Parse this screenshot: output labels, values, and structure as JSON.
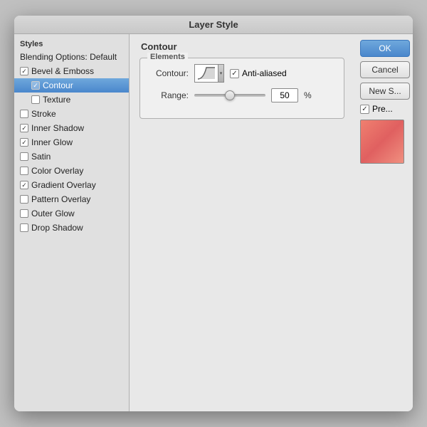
{
  "dialog": {
    "title": "Layer Style",
    "left_panel": {
      "header": "Styles",
      "items": [
        {
          "id": "blending-options",
          "label": "Blending Options: Default",
          "type": "header",
          "checked": false,
          "selected": false
        },
        {
          "id": "bevel-emboss",
          "label": "Bevel & Emboss",
          "type": "parent",
          "checked": true,
          "selected": false
        },
        {
          "id": "contour",
          "label": "Contour",
          "type": "sub",
          "checked": true,
          "selected": true
        },
        {
          "id": "texture",
          "label": "Texture",
          "type": "sub",
          "checked": false,
          "selected": false
        },
        {
          "id": "stroke",
          "label": "Stroke",
          "type": "top",
          "checked": false,
          "selected": false
        },
        {
          "id": "inner-shadow",
          "label": "Inner Shadow",
          "type": "top",
          "checked": true,
          "selected": false
        },
        {
          "id": "inner-glow",
          "label": "Inner Glow",
          "type": "top",
          "checked": true,
          "selected": false
        },
        {
          "id": "satin",
          "label": "Satin",
          "type": "top",
          "checked": false,
          "selected": false
        },
        {
          "id": "color-overlay",
          "label": "Color Overlay",
          "type": "top",
          "checked": false,
          "selected": false
        },
        {
          "id": "gradient-overlay",
          "label": "Gradient Overlay",
          "type": "top",
          "checked": true,
          "selected": false
        },
        {
          "id": "pattern-overlay",
          "label": "Pattern Overlay",
          "type": "top",
          "checked": false,
          "selected": false
        },
        {
          "id": "outer-glow",
          "label": "Outer Glow",
          "type": "top",
          "checked": false,
          "selected": false
        },
        {
          "id": "drop-shadow",
          "label": "Drop Shadow",
          "type": "top",
          "checked": false,
          "selected": false
        }
      ]
    },
    "main": {
      "outer_label": "Contour",
      "section_label": "Elements",
      "contour_label": "Contour:",
      "anti_aliased_label": "Anti-aliased",
      "anti_aliased_checked": true,
      "range_label": "Range:",
      "range_value": "50",
      "range_percent": "%"
    },
    "right": {
      "ok_label": "OK",
      "cancel_label": "Cancel",
      "new_style_label": "New S...",
      "preview_label": "Pre..."
    }
  }
}
